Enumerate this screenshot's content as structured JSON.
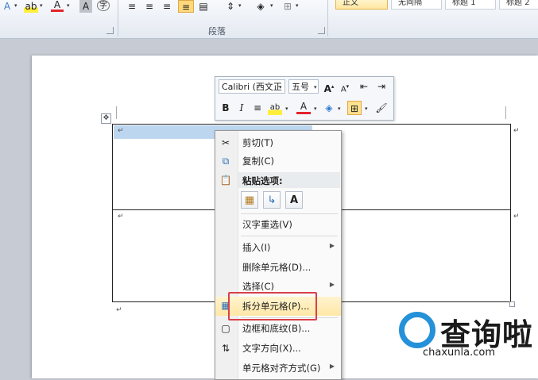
{
  "ribbon": {
    "paragraph_group_label": "段落",
    "styles": [
      "正文",
      "无间隔",
      "标题 1",
      "标题 2"
    ],
    "icons": [
      "text-effect-icon",
      "highlight-icon",
      "font-color-icon",
      "char-shading-icon",
      "phonetic-guide-icon",
      "align-left-icon",
      "center-icon",
      "align-right-icon",
      "justify-icon",
      "distributed-icon",
      "line-spacing-icon",
      "shading-icon",
      "borders-icon"
    ]
  },
  "mini_toolbar": {
    "font": "Calibri (西文正",
    "size": "五号",
    "grow_font_label": "A",
    "shrink_font_label": "A",
    "bold": "B",
    "italic": "I",
    "font_color_label": "A",
    "highlight_label": "ab"
  },
  "context_menu": {
    "items": [
      {
        "label": "剪切(T)",
        "icon": "scissors-icon"
      },
      {
        "label": "复制(C)",
        "icon": "copy-icon"
      },
      {
        "label": "粘贴选项:",
        "icon": "paste-icon"
      },
      {
        "label": "汉字重选(V)",
        "icon": ""
      },
      {
        "label": "插入(I)",
        "icon": "",
        "submenu": true
      },
      {
        "label": "删除单元格(D)...",
        "icon": ""
      },
      {
        "label": "选择(C)",
        "icon": "",
        "submenu": true
      },
      {
        "label": "拆分单元格(P)...",
        "icon": "split-cells-icon"
      },
      {
        "label": "边框和底纹(B)...",
        "icon": "borders-shading-icon"
      },
      {
        "label": "文字方向(X)...",
        "icon": "text-direction-icon"
      },
      {
        "label": "单元格对齐方式(G)",
        "icon": "",
        "submenu": true
      }
    ],
    "paste_options": [
      "keep-source-formatting-icon",
      "merge-formatting-icon",
      "keep-text-only-icon"
    ],
    "paste_text_only_label": "A"
  },
  "watermark": {
    "brand": "查询啦",
    "url": "chaxunla.com"
  },
  "colors": {
    "accent": "#2591d8",
    "highlight_box": "#d8404a",
    "hover": "#ffe7a6"
  }
}
